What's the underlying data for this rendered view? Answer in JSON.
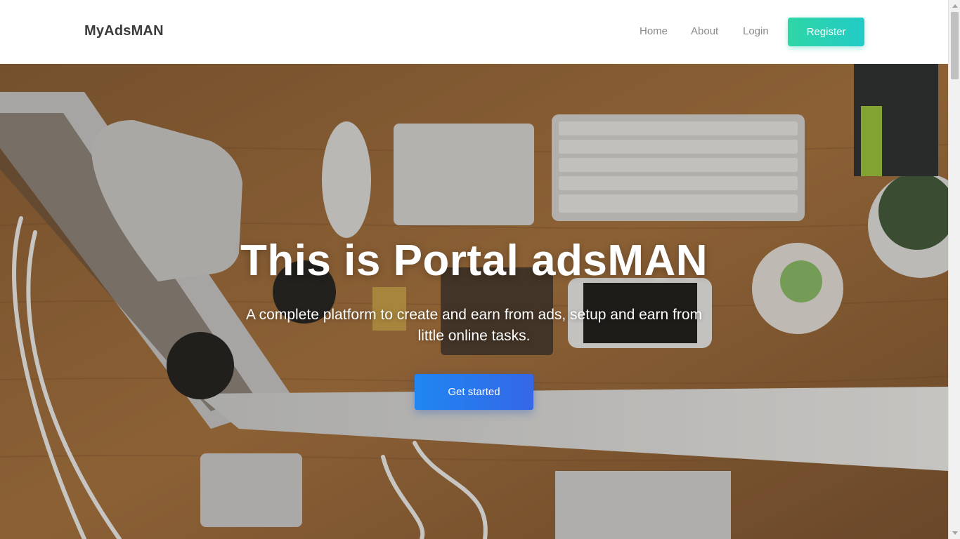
{
  "navbar": {
    "brand": "MyAdsMAN",
    "links": {
      "home": "Home",
      "about": "About",
      "login": "Login"
    },
    "register_label": "Register",
    "register_color": "#2fd6a6"
  },
  "hero": {
    "title": "This is Portal adsMAN",
    "subtitle": "A complete platform to create and earn from ads, setup and earn from little online tasks.",
    "cta_label": "Get started",
    "cta_color": "#1f86f2",
    "background": "desk-workspace-photo"
  },
  "icons": {
    "scroll_up": "triangle-up-icon",
    "scroll_down": "triangle-down-icon"
  }
}
